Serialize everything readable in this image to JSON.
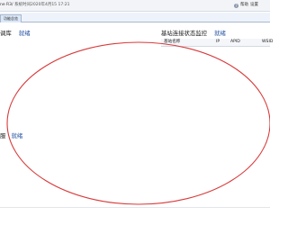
{
  "topbar": {
    "version": "ne R3/",
    "time_label": "系统时间",
    "time_value": "2020年4月15 17:21",
    "help_label": "帮助",
    "settings_label": "设置"
  },
  "tabbar": {
    "active_tab": "功能总览"
  },
  "panels": {
    "left_top": {
      "title": "调库",
      "status": "就绪"
    },
    "right_top": {
      "title": "基站连接状态监控",
      "status": "就绪",
      "columns": [
        "基站名称",
        "IP",
        "APID",
        "WSID"
      ]
    },
    "left_bottom": {
      "title": "服",
      "status": "就绪"
    }
  },
  "annotation": {
    "stroke_color": "#d83a3a"
  },
  "colors": {
    "status_text": "#1f4fa0",
    "header_bg": "#f4f6fa"
  }
}
